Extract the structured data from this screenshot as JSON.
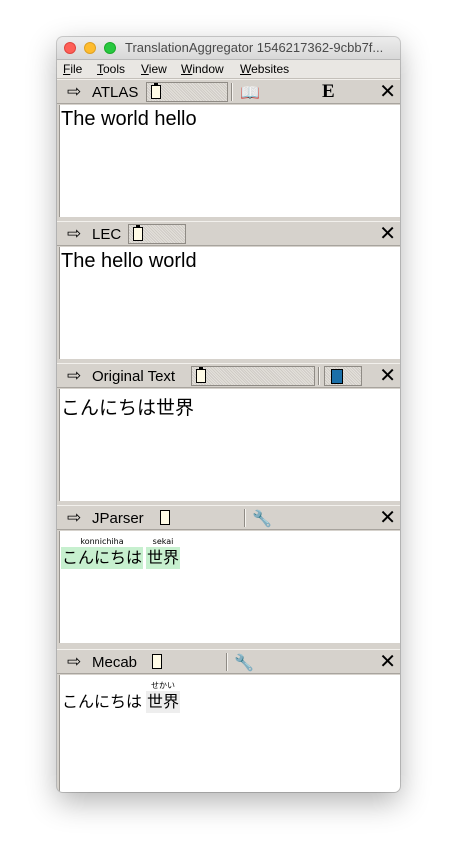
{
  "window": {
    "title": "TranslationAggregator 1546217362-9cbb7f..."
  },
  "menu": [
    {
      "label": "File",
      "accel": "F",
      "rest": "ile"
    },
    {
      "label": "Tools",
      "accel": "T",
      "rest": "ools"
    },
    {
      "label": "View",
      "accel": "V",
      "rest": "iew"
    },
    {
      "label": "Window",
      "accel": "W",
      "rest": "indow"
    },
    {
      "label": "Websites",
      "accel": "W",
      "rest": "ebsites"
    }
  ],
  "panes": {
    "atlas": {
      "label": "ATLAS",
      "text": "The world hello",
      "icons": [
        "arrow-icon",
        "clipboard-icon",
        "book-icon",
        "e-icon",
        "close-icon"
      ]
    },
    "lec": {
      "label": "LEC",
      "text": "The hello world"
    },
    "original": {
      "label": "Original Text",
      "text": "こんにちは世界"
    },
    "jparser": {
      "label": "JParser",
      "words": [
        {
          "kana": "こんにちは",
          "reading": "konnichiha"
        },
        {
          "kana": "世界",
          "reading": "sekai"
        }
      ]
    },
    "mecab": {
      "label": "Mecab",
      "words": [
        {
          "kana": "こんにちは",
          "reading": ""
        },
        {
          "kana": "世界",
          "reading": "せかい"
        }
      ]
    }
  },
  "colors": {
    "toolbar": "#d6d2cc",
    "highlight": "#c7f0cf",
    "close_light": "#fe5f57",
    "min_light": "#febc2e",
    "max_light": "#28c840"
  }
}
